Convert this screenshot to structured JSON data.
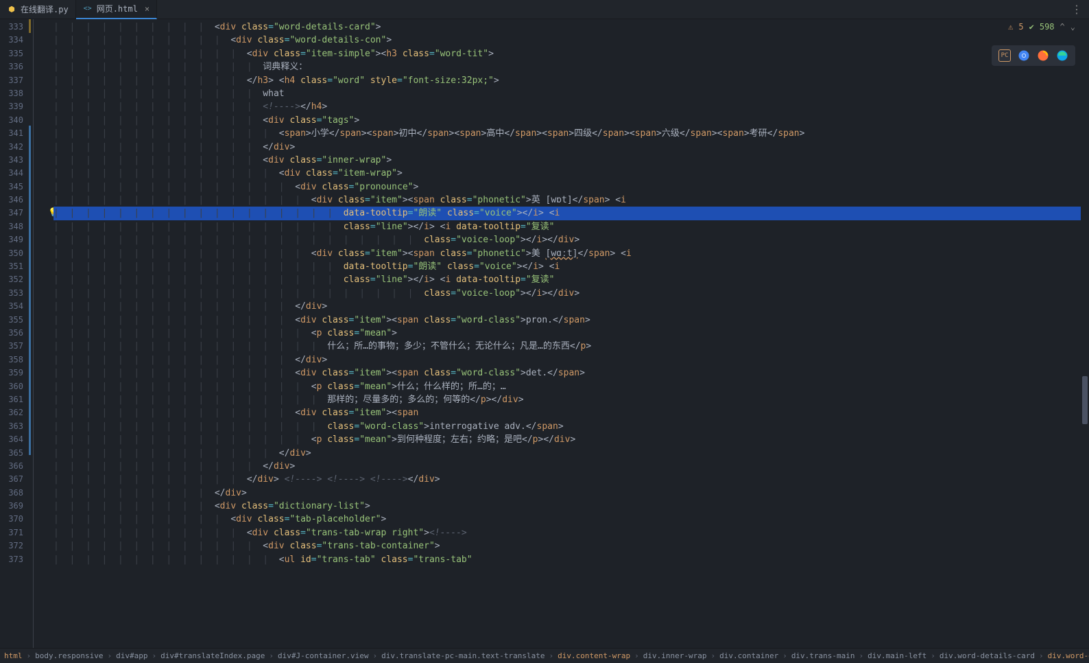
{
  "tabs": [
    {
      "label": "在线翻译.py",
      "type": "py",
      "active": false
    },
    {
      "label": "网页.html",
      "type": "html",
      "active": true
    }
  ],
  "status": {
    "warnings": "5",
    "checks": "598"
  },
  "gutter": {
    "start": 333,
    "end": 373,
    "current": 347,
    "bulb_line": 347
  },
  "code_lines": [
    {
      "n": 333,
      "indent": 10,
      "html": "<span class='punct'>&lt;</span><span class='tag'>div</span> <span class='attr'>class</span><span class='op'>=</span><span class='str'>\"word-details-card\"</span><span class='punct'>&gt;</span>"
    },
    {
      "n": 334,
      "indent": 11,
      "html": "<span class='punct'>&lt;</span><span class='tag'>div</span> <span class='attr'>class</span><span class='op'>=</span><span class='str'>\"word-details-con\"</span><span class='punct'>&gt;</span>"
    },
    {
      "n": 335,
      "indent": 12,
      "html": "<span class='punct'>&lt;</span><span class='tag'>div</span> <span class='attr'>class</span><span class='op'>=</span><span class='str'>\"item-simple\"</span><span class='punct'>&gt;&lt;</span><span class='tag'>h3</span> <span class='attr'>class</span><span class='op'>=</span><span class='str'>\"word-tit\"</span><span class='punct'>&gt;</span>"
    },
    {
      "n": 336,
      "indent": 13,
      "html": "<span class='text'>词典释义：</span>"
    },
    {
      "n": 337,
      "indent": 12,
      "html": "<span class='punct'>&lt;/</span><span class='tag'>h3</span><span class='punct'>&gt;</span> <span class='punct'>&lt;</span><span class='tag'>h4</span> <span class='attr'>class</span><span class='op'>=</span><span class='str'>\"word\"</span> <span class='attr'>style</span><span class='op'>=</span><span class='str'>\"font-size:32px;\"</span><span class='punct'>&gt;</span>"
    },
    {
      "n": 338,
      "indent": 13,
      "html": "<span class='text'>what</span>"
    },
    {
      "n": 339,
      "indent": 13,
      "html": "<span class='cmt'>&lt;!----&gt;</span><span class='punct'>&lt;/</span><span class='tag'>h4</span><span class='punct'>&gt;</span>"
    },
    {
      "n": 340,
      "indent": 13,
      "html": "<span class='punct'>&lt;</span><span class='tag'>div</span> <span class='attr'>class</span><span class='op'>=</span><span class='str'>\"tags\"</span><span class='punct'>&gt;</span>"
    },
    {
      "n": 341,
      "indent": 14,
      "html": "<span class='punct'>&lt;</span><span class='tag'>span</span><span class='punct'>&gt;</span><span class='text'>小学</span><span class='punct'>&lt;/</span><span class='tag'>span</span><span class='punct'>&gt;&lt;</span><span class='tag'>span</span><span class='punct'>&gt;</span><span class='text'>初中</span><span class='punct'>&lt;/</span><span class='tag'>span</span><span class='punct'>&gt;&lt;</span><span class='tag'>span</span><span class='punct'>&gt;</span><span class='text'>高中</span><span class='punct'>&lt;/</span><span class='tag'>span</span><span class='punct'>&gt;&lt;</span><span class='tag'>span</span><span class='punct'>&gt;</span><span class='text'>四级</span><span class='punct'>&lt;/</span><span class='tag'>span</span><span class='punct'>&gt;&lt;</span><span class='tag'>span</span><span class='punct'>&gt;</span><span class='text'>六级</span><span class='punct'>&lt;/</span><span class='tag'>span</span><span class='punct'>&gt;&lt;</span><span class='tag'>span</span><span class='punct'>&gt;</span><span class='text'>考研</span><span class='punct'>&lt;/</span><span class='tag'>span</span><span class='punct'>&gt;</span>"
    },
    {
      "n": 342,
      "indent": 13,
      "html": "<span class='punct'>&lt;/</span><span class='tag'>div</span><span class='punct'>&gt;</span>"
    },
    {
      "n": 343,
      "indent": 13,
      "html": "<span class='punct'>&lt;</span><span class='tag'>div</span> <span class='attr'>class</span><span class='op'>=</span><span class='str'>\"inner-wrap\"</span><span class='punct'>&gt;</span>"
    },
    {
      "n": 344,
      "indent": 14,
      "html": "<span class='punct'>&lt;</span><span class='tag'>div</span> <span class='attr'>class</span><span class='op'>=</span><span class='str'>\"item-wrap\"</span><span class='punct'>&gt;</span>"
    },
    {
      "n": 345,
      "indent": 15,
      "html": "<span class='punct'>&lt;</span><span class='tag'>div</span> <span class='attr'>class</span><span class='op'>=</span><span class='str'>\"pronounce\"</span><span class='punct'>&gt;</span>"
    },
    {
      "n": 346,
      "indent": 16,
      "html": "<span class='punct'>&lt;</span><span class='tag'>div</span> <span class='attr'>class</span><span class='op'>=</span><span class='str'>\"item\"</span><span class='punct'>&gt;&lt;</span><span class='tag'>span</span> <span class='attr'>class</span><span class='op'>=</span><span class='str'>\"phonetic\"</span><span class='punct'>&gt;</span><span class='text'>英 [wɒt]</span><span class='punct'>&lt;/</span><span class='tag'>span</span><span class='punct'>&gt;</span> <span class='punct'>&lt;</span><span class='tag'>i</span>"
    },
    {
      "n": 347,
      "indent": 18,
      "html": "<span class='attr'>data-tooltip</span><span class='op'>=</span><span class='str'>\"朗读\"</span> <span class='attr'>class</span><span class='op'>=</span><span class='str'>\"voice\"</span><span class='punct'>&gt;&lt;/</span><span class='tag'>i</span><span class='punct'>&gt;</span> <span class='punct'>&lt;</span><span class='tag'>i</span>",
      "current": true
    },
    {
      "n": 348,
      "indent": 18,
      "html": "<span class='attr'>class</span><span class='op'>=</span><span class='str'>\"line\"</span><span class='punct'>&gt;&lt;/</span><span class='tag'>i</span><span class='punct'>&gt;</span> <span class='punct'>&lt;</span><span class='tag'>i</span> <span class='attr'>data-tooltip</span><span class='op'>=</span><span class='str'>\"复读\"</span>"
    },
    {
      "n": 349,
      "indent": 23,
      "html": "<span class='attr'>class</span><span class='op'>=</span><span class='str'>\"voice-loop\"</span><span class='punct'>&gt;&lt;/</span><span class='tag'>i</span><span class='punct'>&gt;&lt;/</span><span class='tag'>div</span><span class='punct'>&gt;</span>"
    },
    {
      "n": 350,
      "indent": 16,
      "html": "<span class='punct'>&lt;</span><span class='tag'>div</span> <span class='attr'>class</span><span class='op'>=</span><span class='str'>\"item\"</span><span class='punct'>&gt;&lt;</span><span class='tag'>span</span> <span class='attr'>class</span><span class='op'>=</span><span class='str'>\"phonetic\"</span><span class='punct'>&gt;</span><span class='text'>美 <span class='warn-ul'>[wɑːt]</span></span><span class='punct'>&lt;/</span><span class='tag'>span</span><span class='punct'>&gt;</span> <span class='punct'>&lt;</span><span class='tag'>i</span>"
    },
    {
      "n": 351,
      "indent": 18,
      "html": "<span class='attr'>data-tooltip</span><span class='op'>=</span><span class='str'>\"朗读\"</span> <span class='attr'>class</span><span class='op'>=</span><span class='str'>\"voice\"</span><span class='punct'>&gt;&lt;/</span><span class='tag'>i</span><span class='punct'>&gt;</span> <span class='punct'>&lt;</span><span class='tag'>i</span>"
    },
    {
      "n": 352,
      "indent": 18,
      "html": "<span class='attr'>class</span><span class='op'>=</span><span class='str'>\"line\"</span><span class='punct'>&gt;&lt;/</span><span class='tag'>i</span><span class='punct'>&gt;</span> <span class='punct'>&lt;</span><span class='tag'>i</span> <span class='attr'>data-tooltip</span><span class='op'>=</span><span class='str'>\"复读\"</span>"
    },
    {
      "n": 353,
      "indent": 23,
      "html": "<span class='attr'>class</span><span class='op'>=</span><span class='str'>\"voice-loop\"</span><span class='punct'>&gt;&lt;/</span><span class='tag'>i</span><span class='punct'>&gt;&lt;/</span><span class='tag'>div</span><span class='punct'>&gt;</span>"
    },
    {
      "n": 354,
      "indent": 15,
      "html": "<span class='punct'>&lt;/</span><span class='tag'>div</span><span class='punct'>&gt;</span>"
    },
    {
      "n": 355,
      "indent": 15,
      "html": "<span class='punct'>&lt;</span><span class='tag'>div</span> <span class='attr'>class</span><span class='op'>=</span><span class='str'>\"item\"</span><span class='punct'>&gt;&lt;</span><span class='tag'>span</span> <span class='attr'>class</span><span class='op'>=</span><span class='str'>\"word-class\"</span><span class='punct'>&gt;</span><span class='text'>pron.</span><span class='punct'>&lt;/</span><span class='tag'>span</span><span class='punct'>&gt;</span>"
    },
    {
      "n": 356,
      "indent": 16,
      "html": "<span class='punct'>&lt;</span><span class='tag'>p</span> <span class='attr'>class</span><span class='op'>=</span><span class='str'>\"mean\"</span><span class='punct'>&gt;</span>"
    },
    {
      "n": 357,
      "indent": 17,
      "html": "<span class='text'>什么；所…的事物；多少；不管什么；无论什么；凡是…的东西</span><span class='punct'>&lt;/</span><span class='tag'>p</span><span class='punct'>&gt;</span>"
    },
    {
      "n": 358,
      "indent": 15,
      "html": "<span class='punct'>&lt;/</span><span class='tag'>div</span><span class='punct'>&gt;</span>"
    },
    {
      "n": 359,
      "indent": 15,
      "html": "<span class='punct'>&lt;</span><span class='tag'>div</span> <span class='attr'>class</span><span class='op'>=</span><span class='str'>\"item\"</span><span class='punct'>&gt;&lt;</span><span class='tag'>span</span> <span class='attr'>class</span><span class='op'>=</span><span class='str'>\"word-class\"</span><span class='punct'>&gt;</span><span class='text'>det.</span><span class='punct'>&lt;/</span><span class='tag'>span</span><span class='punct'>&gt;</span>"
    },
    {
      "n": 360,
      "indent": 16,
      "html": "<span class='punct'>&lt;</span><span class='tag'>p</span> <span class='attr'>class</span><span class='op'>=</span><span class='str'>\"mean\"</span><span class='punct'>&gt;</span><span class='text'>什么；什么样的；所…的；…</span>"
    },
    {
      "n": 361,
      "indent": 17,
      "html": "<span class='text'>那样的；尽量多的；多么的；何等的</span><span class='punct'>&lt;/</span><span class='tag'>p</span><span class='punct'>&gt;&lt;/</span><span class='tag'>div</span><span class='punct'>&gt;</span>"
    },
    {
      "n": 362,
      "indent": 15,
      "html": "<span class='punct'>&lt;</span><span class='tag'>div</span> <span class='attr'>class</span><span class='op'>=</span><span class='str'>\"item\"</span><span class='punct'>&gt;&lt;</span><span class='tag'>span</span>"
    },
    {
      "n": 363,
      "indent": 17,
      "html": "<span class='attr'>class</span><span class='op'>=</span><span class='str'>\"word-class\"</span><span class='punct'>&gt;</span><span class='text'>interrogative adv.</span><span class='punct'>&lt;/</span><span class='tag'>span</span><span class='punct'>&gt;</span>"
    },
    {
      "n": 364,
      "indent": 16,
      "html": "<span class='punct'>&lt;</span><span class='tag'>p</span> <span class='attr'>class</span><span class='op'>=</span><span class='str'>\"mean\"</span><span class='punct'>&gt;</span><span class='text'>到何种程度；左右；约略；是吧</span><span class='punct'>&lt;/</span><span class='tag'>p</span><span class='punct'>&gt;&lt;/</span><span class='tag'>div</span><span class='punct'>&gt;</span>"
    },
    {
      "n": 365,
      "indent": 14,
      "html": "<span class='punct'>&lt;/</span><span class='tag'>div</span><span class='punct'>&gt;</span>"
    },
    {
      "n": 366,
      "indent": 13,
      "html": "<span class='punct'>&lt;/</span><span class='tag'>div</span><span class='punct'>&gt;</span>"
    },
    {
      "n": 367,
      "indent": 12,
      "html": "<span class='punct'>&lt;/</span><span class='tag'>div</span><span class='punct'>&gt;</span> <span class='cmt'>&lt;!----&gt;</span> <span class='cmt'>&lt;!----&gt;</span> <span class='cmt'>&lt;!----&gt;</span><span class='punct'>&lt;/</span><span class='tag'>div</span><span class='punct'>&gt;</span>"
    },
    {
      "n": 368,
      "indent": 10,
      "html": "<span class='punct'>&lt;/</span><span class='tag'>div</span><span class='punct'>&gt;</span>"
    },
    {
      "n": 369,
      "indent": 10,
      "html": "<span class='punct'>&lt;</span><span class='tag'>div</span> <span class='attr'>class</span><span class='op'>=</span><span class='str'>\"dictionary-list\"</span><span class='punct'>&gt;</span>"
    },
    {
      "n": 370,
      "indent": 11,
      "html": "<span class='punct'>&lt;</span><span class='tag'>div</span> <span class='attr'>class</span><span class='op'>=</span><span class='str'>\"tab-placeholder\"</span><span class='punct'>&gt;</span>"
    },
    {
      "n": 371,
      "indent": 12,
      "html": "<span class='punct'>&lt;</span><span class='tag'>div</span> <span class='attr'>class</span><span class='op'>=</span><span class='str'>\"trans-tab-wrap right\"</span><span class='punct'>&gt;</span><span class='cmt'>&lt;!----&gt;</span>"
    },
    {
      "n": 372,
      "indent": 13,
      "html": "<span class='punct'>&lt;</span><span class='tag'>div</span> <span class='attr'>class</span><span class='op'>=</span><span class='str'>\"trans-tab-container\"</span><span class='punct'>&gt;</span>"
    },
    {
      "n": 373,
      "indent": 14,
      "html": "<span class='punct'>&lt;</span><span class='tag'>ul</span> <span class='attr'>id</span><span class='op'>=</span><span class='str'>\"trans-tab\"</span> <span class='attr'>class</span><span class='op'>=</span><span class='str'>\"trans-tab\"</span>"
    }
  ],
  "breadcrumb": [
    {
      "label": "html",
      "class": "orange"
    },
    {
      "label": "body.responsive",
      "class": ""
    },
    {
      "label": "div#app",
      "class": ""
    },
    {
      "label": "div#translateIndex.page",
      "class": ""
    },
    {
      "label": "div#J-container.view",
      "class": ""
    },
    {
      "label": "div.translate-pc-main.text-translate",
      "class": ""
    },
    {
      "label": "div.content-wrap",
      "class": "orange"
    },
    {
      "label": "div.inner-wrap",
      "class": ""
    },
    {
      "label": "div.container",
      "class": ""
    },
    {
      "label": "div.trans-main",
      "class": ""
    },
    {
      "label": "div.main-left",
      "class": ""
    },
    {
      "label": "div.word-details-card",
      "class": ""
    },
    {
      "label": "div.word-details-con",
      "class": "orange"
    }
  ]
}
